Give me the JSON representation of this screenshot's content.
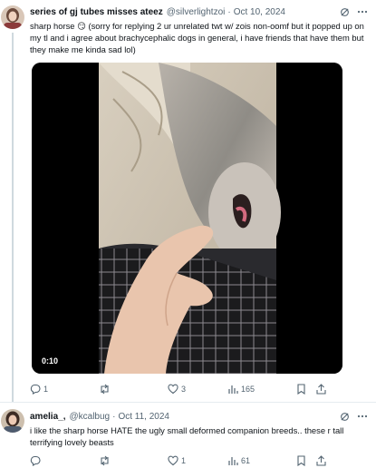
{
  "tweet1": {
    "display_name": "series of gj tubes misses ateez",
    "handle": "@silverlightzoi",
    "separator": "·",
    "date": "Oct 10, 2024",
    "text": "sharp horse 😏 (sorry for replying 2 ur unrelated twt w/ zois non-oomf but it popped up on my tl and i agree about brachycephalic dogs in general, i have friends that have them but they make me kinda sad lol)",
    "video_duration": "0:10",
    "replies": "1",
    "retweets": "",
    "likes": "3",
    "views": "165"
  },
  "tweet2": {
    "display_name": "amelia_,",
    "handle": "@kcalbug",
    "separator": "·",
    "date": "Oct 11, 2024",
    "text": "i like the sharp horse HATE the ugly small deformed companion breeds.. these r tall terrifying lovely beasts",
    "replies": "",
    "retweets": "",
    "likes": "1",
    "views": "61"
  },
  "icons": {
    "grok": "grok-icon",
    "more": "more-icon",
    "reply": "reply-icon",
    "retweet": "retweet-icon",
    "like": "heart-icon",
    "views": "views-icon",
    "bookmark": "bookmark-icon",
    "share": "share-icon"
  },
  "colors": {
    "text": "#0f1419",
    "muted": "#536471",
    "border": "#e6ecf0",
    "line": "#cfd9de"
  }
}
